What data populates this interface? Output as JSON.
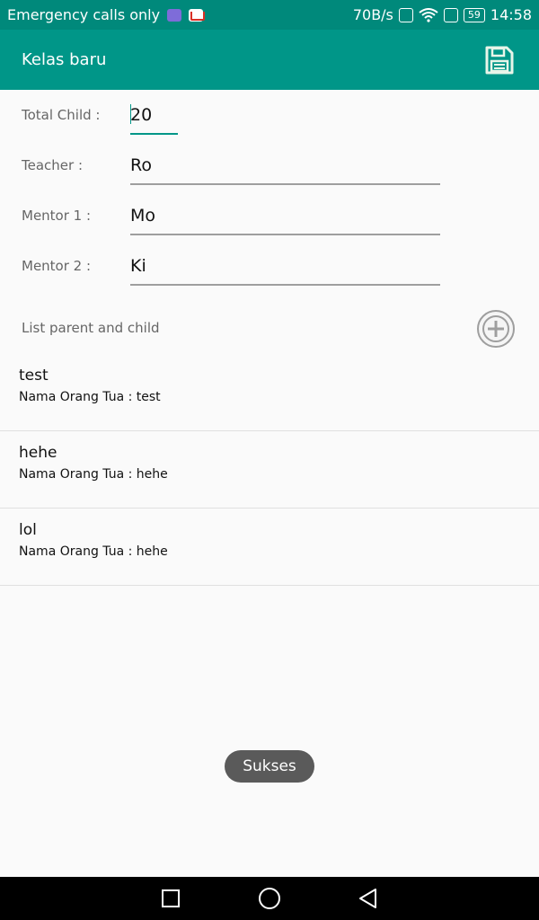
{
  "status_bar": {
    "carrier_text": "Emergency calls only",
    "net_speed": "70B/s",
    "battery": "59",
    "time": "14:58",
    "icons": [
      "viber-icon",
      "gmail-icon",
      "vibrate-icon",
      "wifi-icon",
      "sim-icon"
    ]
  },
  "appbar": {
    "title": "Kelas baru",
    "save_icon": "save-icon"
  },
  "form": {
    "total_child_label": "Total Child :",
    "total_child_value": "20",
    "teacher_label": "Teacher :",
    "teacher_value": "Ro",
    "mentor1_label": "Mentor 1 :",
    "mentor1_value": "Mo",
    "mentor2_label": "Mentor 2 :",
    "mentor2_value": "Ki"
  },
  "list": {
    "header_label": "List parent and child",
    "add_icon": "add-circle-icon",
    "items": [
      {
        "name": "test",
        "parent": "Nama Orang Tua : test"
      },
      {
        "name": "hehe",
        "parent": "Nama Orang Tua : hehe"
      },
      {
        "name": "lol",
        "parent": "Nama Orang Tua : hehe"
      }
    ]
  },
  "toast": "Sukses",
  "colors": {
    "primary": "#009688",
    "status_bar": "#00897b",
    "toast": "#5a5a5a"
  }
}
